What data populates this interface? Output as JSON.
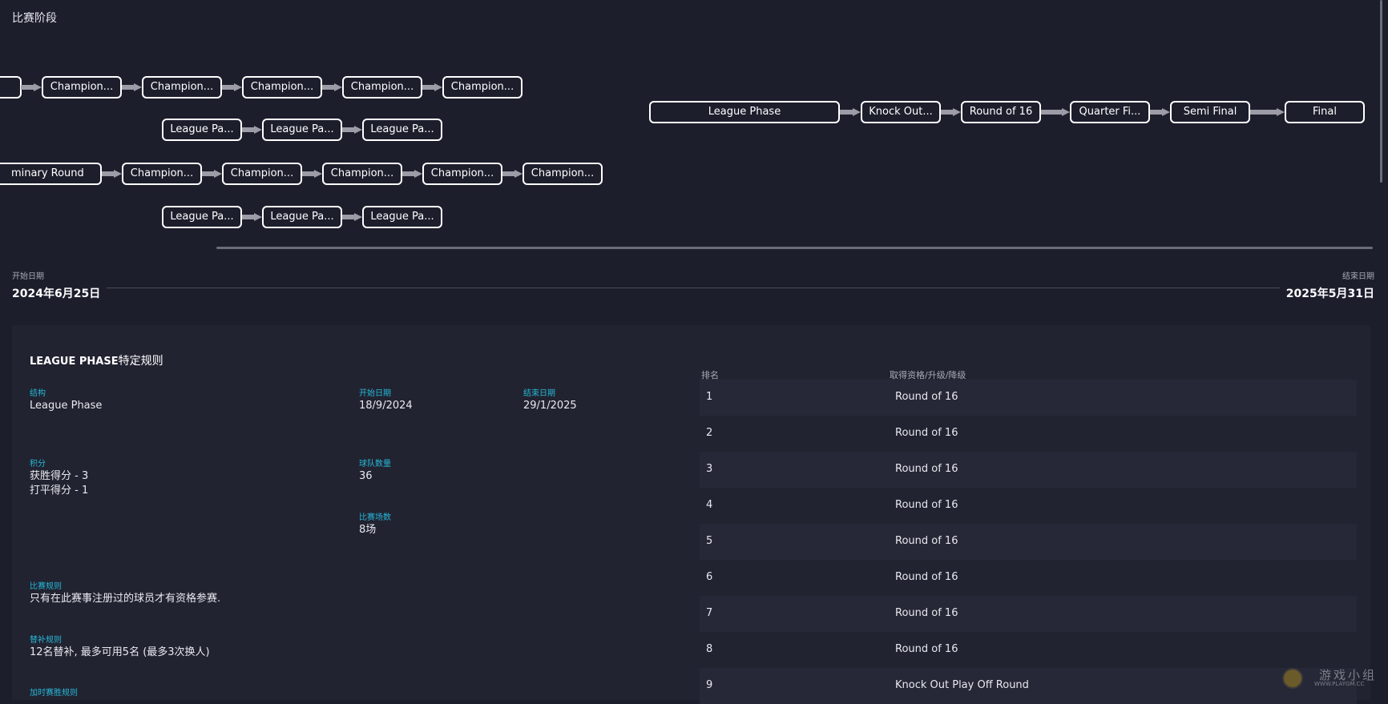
{
  "section_title": "比赛阶段",
  "flow": {
    "row1": [
      "",
      "Champion...",
      "Champion...",
      "Champion...",
      "Champion...",
      "Champion..."
    ],
    "row2": [
      "League Pa...",
      "League Pa...",
      "League Pa..."
    ],
    "row3": [
      "minary Round",
      "Champion...",
      "Champion...",
      "Champion...",
      "Champion...",
      "Champion..."
    ],
    "row4": [
      "League Pa...",
      "League Pa...",
      "League Pa..."
    ],
    "main": [
      "League Phase",
      "Knock Out...",
      "Round of 16",
      "Quarter Fi...",
      "Semi Final",
      "Final"
    ]
  },
  "dates": {
    "start_label": "开始日期",
    "start_value": "2024年6月25日",
    "end_label": "结束日期",
    "end_value": "2025年5月31日"
  },
  "rules": {
    "title_bold": "LEAGUE PHASE",
    "title_rest": "特定规则",
    "structure_label": "结构",
    "structure_value": "League Phase",
    "start_label": "开始日期",
    "start_value": "18/9/2024",
    "end_label": "结束日期",
    "end_value": "29/1/2025",
    "points_label": "积分",
    "points_win": "获胜得分 - 3",
    "points_draw": "打平得分 - 1",
    "teams_label": "球队数量",
    "teams_value": "36",
    "matches_label": "比赛场数",
    "matches_value": "8场",
    "match_rules_label": "比赛规则",
    "match_rules_value": "只有在此赛事注册过的球员才有资格参赛.",
    "sub_rules_label": "替补规则",
    "sub_rules_value": "12名替补, 最多可用5名 (最多3次换人)",
    "cut_label": "加时赛胜规则"
  },
  "table": {
    "col_rank": "排名",
    "col_qual": "取得资格/升级/降级",
    "rows": [
      {
        "rank": "1",
        "qual": "Round of 16"
      },
      {
        "rank": "2",
        "qual": "Round of 16"
      },
      {
        "rank": "3",
        "qual": "Round of 16"
      },
      {
        "rank": "4",
        "qual": "Round of 16"
      },
      {
        "rank": "5",
        "qual": "Round of 16"
      },
      {
        "rank": "6",
        "qual": "Round of 16"
      },
      {
        "rank": "7",
        "qual": "Round of 16"
      },
      {
        "rank": "8",
        "qual": "Round of 16"
      },
      {
        "rank": "9",
        "qual": "Knock Out Play Off Round"
      }
    ]
  },
  "watermark": {
    "text": "游戏小组",
    "sub": "WWW.PLAYGM.CC"
  }
}
